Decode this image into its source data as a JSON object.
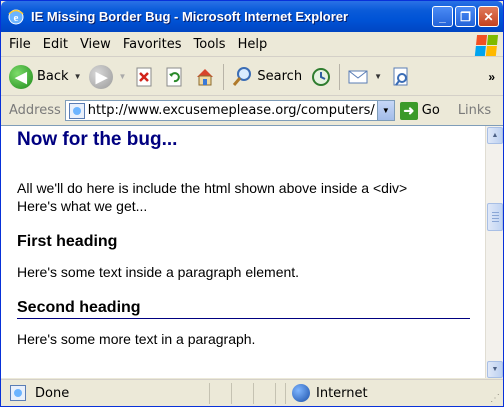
{
  "window": {
    "title": "IE Missing Border Bug - Microsoft Internet Explorer",
    "buttons": {
      "minimize": "_",
      "maximize": "❐",
      "close": "✕"
    }
  },
  "menubar": {
    "items": [
      "File",
      "Edit",
      "View",
      "Favorites",
      "Tools",
      "Help"
    ]
  },
  "toolbar": {
    "back_label": "Back",
    "search_label": "Search",
    "icons": [
      "back-icon",
      "forward-icon",
      "stop-icon",
      "refresh-icon",
      "home-icon",
      "search-icon",
      "history-icon",
      "mail-icon",
      "print-icon"
    ]
  },
  "addressbar": {
    "label": "Address",
    "url": "http://www.excusemeplease.org/computers/",
    "go_label": "Go",
    "links_label": "Links"
  },
  "page": {
    "heading": "Now for the bug...",
    "intro_line1": "All we'll do here is include the html shown above inside a <div>",
    "intro_line2": "Here's what we get...",
    "first_heading": "First heading",
    "first_paragraph": "Here's some text inside a paragraph element.",
    "second_heading": "Second heading",
    "second_paragraph": "Here's some more text in a paragraph."
  },
  "statusbar": {
    "status": "Done",
    "zone": "Internet"
  },
  "colors": {
    "heading": "#000080",
    "titlebar": "#0053d6",
    "window_bg": "#ece9d8"
  }
}
